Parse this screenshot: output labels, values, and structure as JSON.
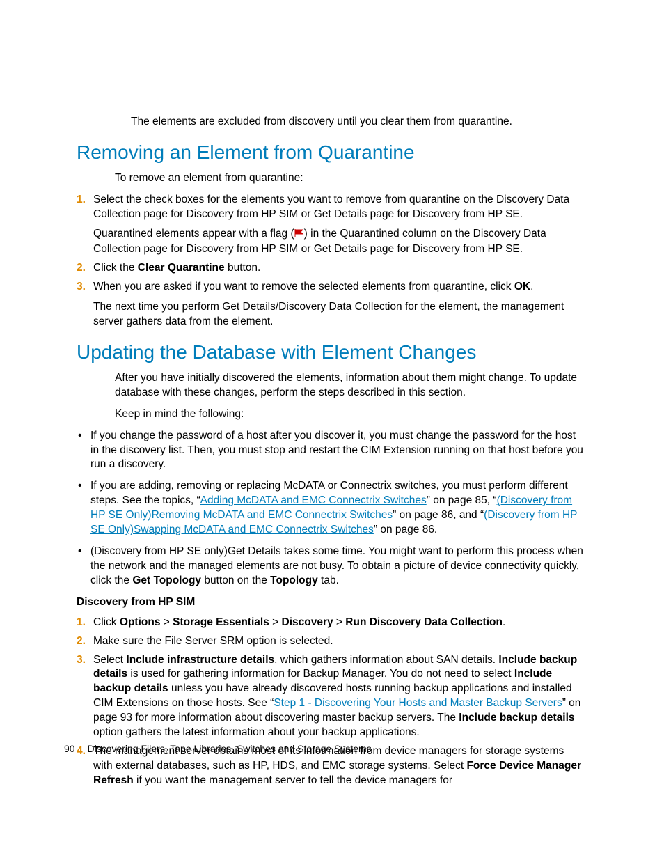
{
  "intro_line": "The elements are excluded from discovery until you clear them from quarantine.",
  "h1": "Removing an Element from Quarantine",
  "h1_intro": "To remove an element from quarantine:",
  "s1_steps": {
    "1a": "Select the check boxes for the elements you want to remove from quarantine on the Discovery Data Collection page for Discovery from HP SIM or Get Details page for Discovery from HP SE.",
    "1b_pre": "Quarantined elements appear with a flag (",
    "1b_post": ") in the Quarantined column on the Discovery Data Collection page for Discovery from HP SIM or Get Details page for Discovery from HP SE.",
    "2_pre": "Click the ",
    "2_b": "Clear Quarantine",
    "2_post": " button.",
    "3_pre": "When you are asked if you want to remove the selected elements from quarantine, click ",
    "3_b": "OK",
    "3_post": ".",
    "3_sub": "The next time you perform Get Details/Discovery Data Collection for the element, the management server gathers data from the element."
  },
  "h2": "Updating the Database with Element Changes",
  "h2_p1": "After you have initially discovered the elements, information about them might change. To update database with these changes, perform the steps described in this section.",
  "h2_p2": "Keep in mind the following:",
  "bullets": {
    "b1": "If you change the password of a host after you discover it, you must change the password for the host in the discovery list. Then, you must stop and restart the CIM Extension running on that host before you run a discovery.",
    "b2_a": "If you are adding, removing or replacing McDATA or Connectrix switches, you must perform different steps. See the topics, “",
    "b2_l1": "Adding McDATA and EMC Connectrix Switches",
    "b2_b": "” on page 85, “",
    "b2_l2": "(Discovery from HP SE Only)Removing McDATA and EMC Connectrix Switches",
    "b2_c": "” on page 86, and “",
    "b2_l3": "(Discovery from HP SE Only)Swapping McDATA and EMC Connectrix Switches",
    "b2_d": "” on page 86.",
    "b3_a": "(Discovery from HP SE only)Get Details takes some time. You might want to perform this process when the network and the managed elements are not busy. To obtain a picture of device connectivity quickly, click the ",
    "b3_b1": "Get Topology",
    "b3_b": " button on the ",
    "b3_b2": "Topology",
    "b3_c": " tab."
  },
  "subhead": "Discovery from HP SIM",
  "s2_steps": {
    "1_a": "Click ",
    "1_b1": "Options",
    "1_gt": " > ",
    "1_b2": "Storage Essentials",
    "1_b3": "Discovery",
    "1_b4": "Run Discovery Data Collection",
    "1_z": ".",
    "2": "Make sure the File Server SRM option is selected.",
    "3_a": "Select ",
    "3_b1": "Include infrastructure details",
    "3_b": ", which gathers information about SAN details. ",
    "3_b2": "Include backup details",
    "3_c": " is used for gathering information for Backup Manager. You do not need to select ",
    "3_b3": "Include backup details",
    "3_d": " unless you have already discovered hosts running backup applications and installed CIM Extensions on those hosts. See “",
    "3_l": "Step 1 - Discovering Your Hosts and Master Backup Servers",
    "3_e": "” on page 93 for more information about discovering master backup servers. The ",
    "3_b4": "Include backup details",
    "3_f": " option gathers the latest information about your backup applications.",
    "4_a": "The management server obtains most of its information from device managers for storage systems with external databases, such as HP, HDS, and EMC storage systems. Select ",
    "4_b1": "Force Device Manager Refresh",
    "4_b": " if you want the management server to tell the device managers for"
  },
  "footer": {
    "page": "90",
    "title": "Discovering Filers, Tape Libraries, Switches and Storage Systems"
  }
}
